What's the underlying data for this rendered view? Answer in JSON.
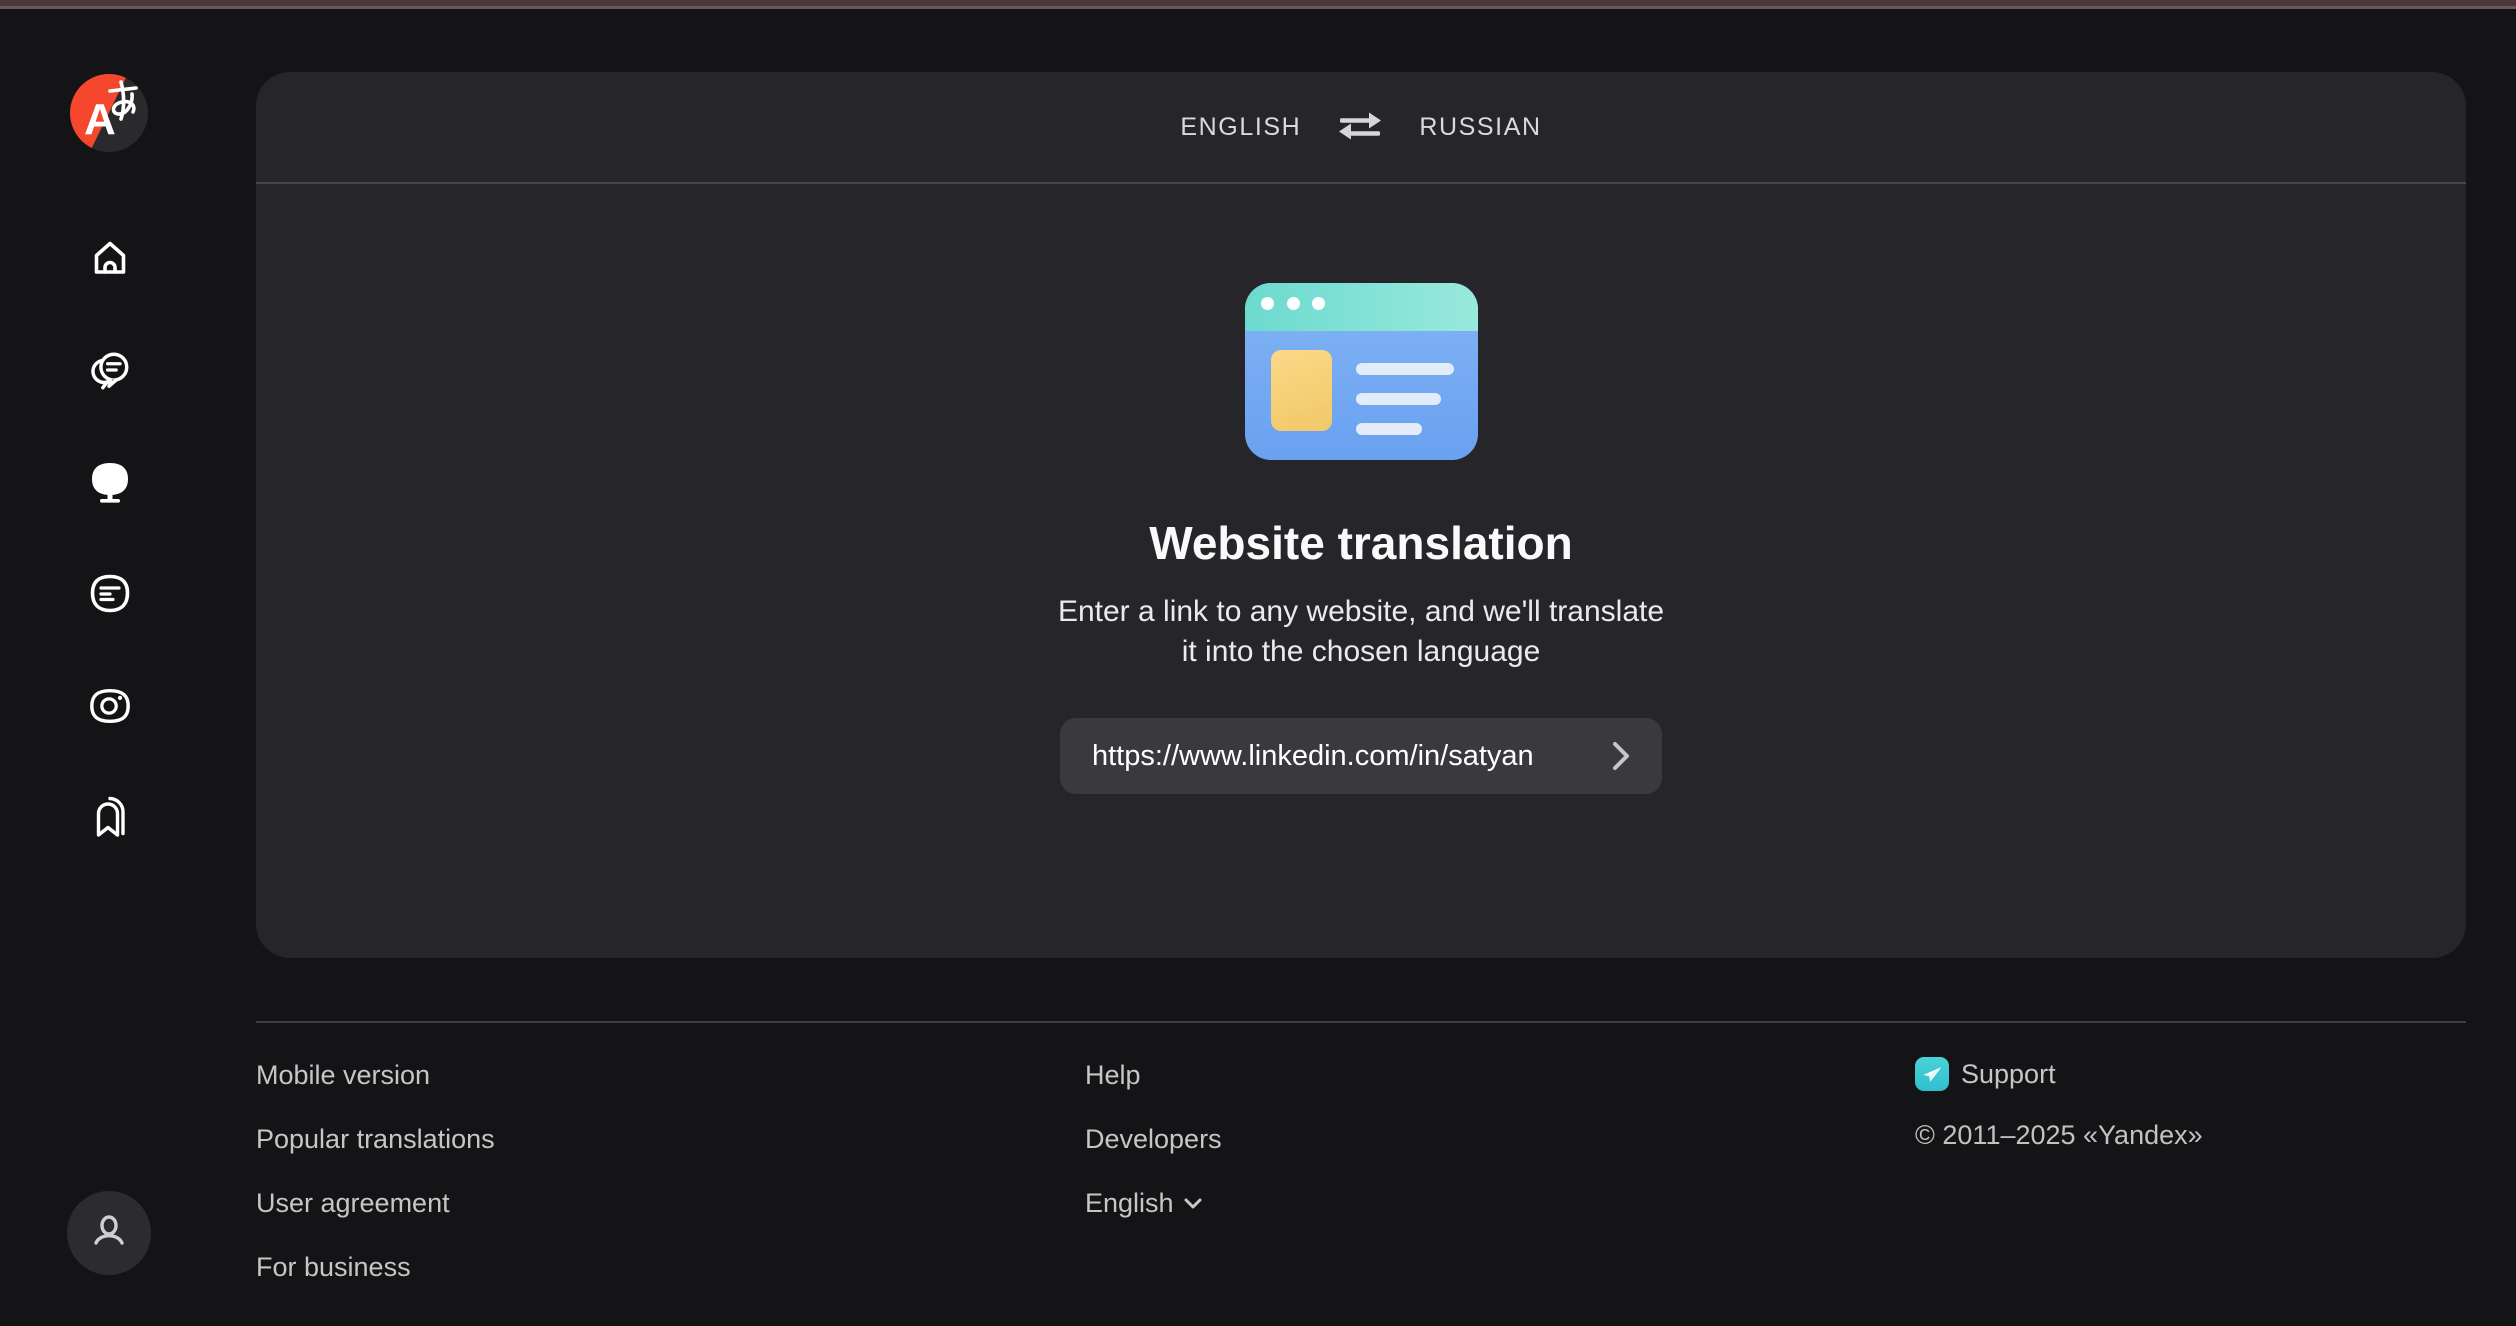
{
  "sidebar": {
    "logo": {
      "latin": "A",
      "hiragana": "あ"
    },
    "items": [
      {
        "label": "home",
        "icon": "home-icon"
      },
      {
        "label": "dialogue",
        "icon": "dialogue-icon"
      },
      {
        "label": "sites",
        "icon": "sites-icon",
        "active": true
      },
      {
        "label": "text",
        "icon": "text-translation-icon"
      },
      {
        "label": "images",
        "icon": "camera-icon"
      },
      {
        "label": "collections",
        "icon": "bookmark-icon"
      }
    ]
  },
  "header": {
    "source_language": "ENGLISH",
    "target_language": "RUSSIAN",
    "swap_icon": "swap-arrows-icon"
  },
  "main": {
    "title": "Website translation",
    "subtitle_line1": "Enter a link to any website, and we'll translate",
    "subtitle_line2": "it into the chosen language",
    "url_value": "https://www.linkedin.com/in/satyan",
    "submit_icon": "chevron-right-icon"
  },
  "footer": {
    "links_col1": [
      "Mobile version",
      "Popular translations",
      "User agreement",
      "For business"
    ],
    "links_col2": [
      "Help",
      "Developers"
    ],
    "language_selector": "English",
    "support_label": "Support",
    "copyright": "© 2011–2025 «Yandex»"
  },
  "colors": {
    "page_background": "#141416",
    "card_background": "#26262a",
    "brand_red": "#f5472e",
    "support_teal": "#3bc9d3",
    "illustration_teal": "#6cdacf",
    "illustration_blue": "#75aaf2",
    "illustration_yellow": "#f7d178",
    "top_strip_maroon": "#4c383b"
  }
}
